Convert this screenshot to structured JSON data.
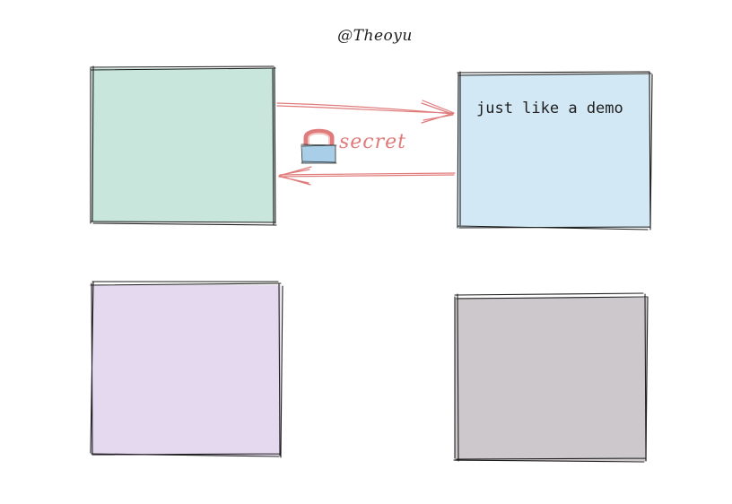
{
  "diagram": {
    "author": "@Theoyu",
    "nodes": [
      {
        "id": "top-left",
        "fill": "#c8e6dc",
        "label": ""
      },
      {
        "id": "top-right",
        "fill": "#d3e8f5",
        "label": "just like a demo"
      },
      {
        "id": "bottom-left",
        "fill": "#e4d9ee",
        "label": ""
      },
      {
        "id": "bottom-right",
        "fill": "#cdc8cc",
        "label": ""
      }
    ],
    "edges": [
      {
        "from": "top-left",
        "to": "top-right",
        "label": ""
      },
      {
        "from": "top-right",
        "to": "top-left",
        "label": "secret"
      }
    ],
    "secret_label": "secret",
    "demo_label": "just like a demo",
    "colors": {
      "stroke": "#1e1e1e",
      "arrow": "#e07b7b",
      "lock_body": "#a9cfe8",
      "lock_shackle": "#e07b7b"
    },
    "icons": [
      "lock-icon"
    ]
  }
}
